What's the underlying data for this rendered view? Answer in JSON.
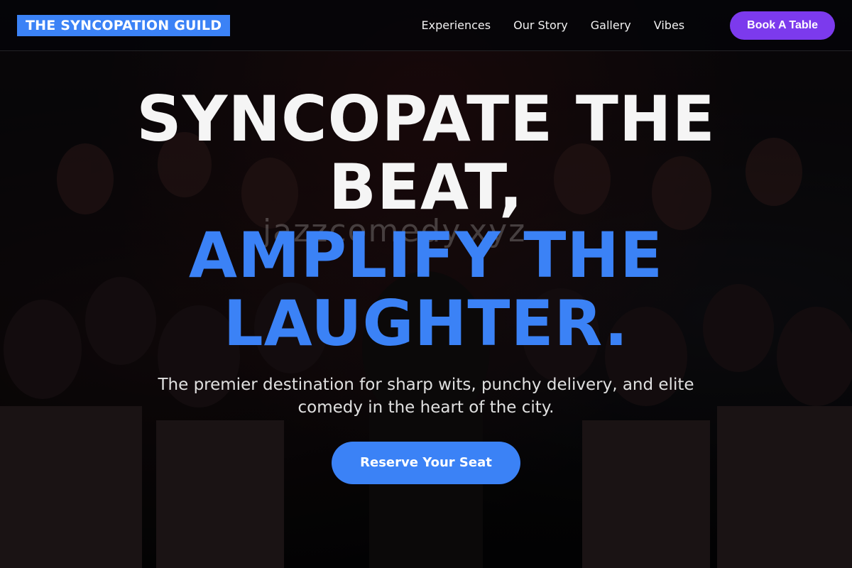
{
  "nav": {
    "logo": "THE SYNCOPATION GUILD",
    "links": [
      "Experiences",
      "Our Story",
      "Gallery",
      "Vibes"
    ],
    "book_label": "Book A Table"
  },
  "hero": {
    "title_line1": "SYNCOPATE THE BEAT,",
    "title_line2": "AMPLIFY THE LAUGHTER.",
    "subtitle": "The premier destination for sharp wits, punchy delivery, and elite comedy in the heart of the city.",
    "cta_label": "Reserve Your Seat",
    "watermark": "jazzcomedy.xyz"
  },
  "colors": {
    "accent_blue": "#3b82f6",
    "accent_purple": "#7c3aed"
  }
}
